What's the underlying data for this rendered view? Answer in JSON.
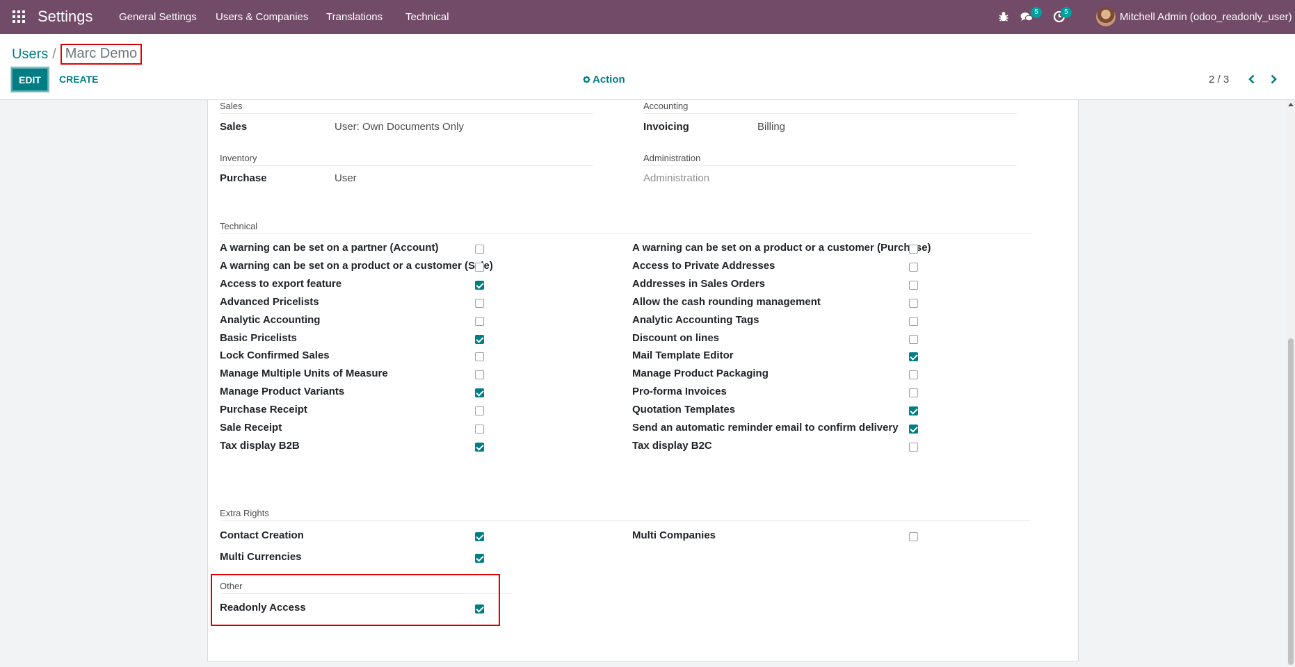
{
  "navbar": {
    "brand": "Settings",
    "menu": [
      "General Settings",
      "Users & Companies",
      "Translations",
      "Technical"
    ],
    "messages_badge": "5",
    "activities_badge": "5",
    "user_name": "Mitchell Admin (odoo_readonly_user)",
    "color": "#714b67"
  },
  "control_panel": {
    "breadcrumb_parent": "Users",
    "breadcrumb_separator": "/",
    "breadcrumb_current": "Marc Demo",
    "edit_label": "EDIT",
    "create_label": "CREATE",
    "action_label": "Action",
    "pager_value": "2 / 3"
  },
  "accent_color": "#017e84",
  "groups": {
    "sales": {
      "title": "Sales",
      "label": "Sales",
      "value": "User: Own Documents Only"
    },
    "accounting": {
      "title": "Accounting",
      "label": "Invoicing",
      "value": "Billing"
    },
    "inventory": {
      "title": "Inventory",
      "label": "Purchase",
      "value": "User"
    },
    "administration": {
      "title": "Administration",
      "value": "Administration"
    }
  },
  "technical": {
    "title": "Technical",
    "left": [
      {
        "label": "A warning can be set on a partner (Account)",
        "checked": false
      },
      {
        "label": "A warning can be set on a product or a customer (Sale)",
        "checked": false
      },
      {
        "label": "Access to export feature",
        "checked": true
      },
      {
        "label": "Advanced Pricelists",
        "checked": false
      },
      {
        "label": "Analytic Accounting",
        "checked": false
      },
      {
        "label": "Basic Pricelists",
        "checked": true
      },
      {
        "label": "Lock Confirmed Sales",
        "checked": false
      },
      {
        "label": "Manage Multiple Units of Measure",
        "checked": false
      },
      {
        "label": "Manage Product Variants",
        "checked": true
      },
      {
        "label": "Purchase Receipt",
        "checked": false
      },
      {
        "label": "Sale Receipt",
        "checked": false
      },
      {
        "label": "Tax display B2B",
        "checked": true
      }
    ],
    "right": [
      {
        "label": "A warning can be set on a product or a customer (Purchase)",
        "checked": false
      },
      {
        "label": "Access to Private Addresses",
        "checked": false
      },
      {
        "label": "Addresses in Sales Orders",
        "checked": false
      },
      {
        "label": "Allow the cash rounding management",
        "checked": false
      },
      {
        "label": "Analytic Accounting Tags",
        "checked": false
      },
      {
        "label": "Discount on lines",
        "checked": false
      },
      {
        "label": "Mail Template Editor",
        "checked": true
      },
      {
        "label": "Manage Product Packaging",
        "checked": false
      },
      {
        "label": "Pro-forma Invoices",
        "checked": false
      },
      {
        "label": "Quotation Templates",
        "checked": true
      },
      {
        "label": "Send an automatic reminder email to confirm delivery",
        "checked": true
      },
      {
        "label": "Tax display B2C",
        "checked": false
      }
    ]
  },
  "extra_rights": {
    "title": "Extra Rights",
    "left": [
      {
        "label": "Contact Creation",
        "checked": true
      },
      {
        "label": "Multi Currencies",
        "checked": true
      }
    ],
    "right": [
      {
        "label": "Multi Companies",
        "checked": false
      }
    ]
  },
  "other": {
    "title": "Other",
    "items": [
      {
        "label": "Readonly Access",
        "checked": true
      }
    ]
  }
}
